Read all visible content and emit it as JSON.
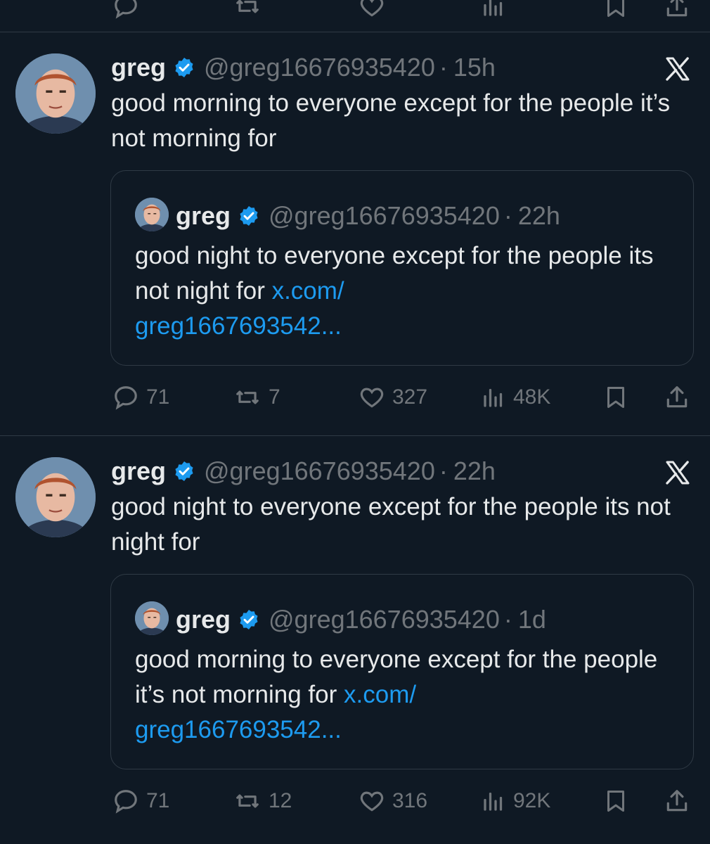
{
  "colors": {
    "background": "#0f1924",
    "text": "#e7e9ea",
    "muted": "#71767b",
    "link": "#1d9bf0",
    "verified": "#1d9bf0",
    "border": "#2f3a45"
  },
  "tweets": [
    {
      "name": "greg",
      "handle": "@greg16676935420",
      "dot": "·",
      "time": "15h",
      "text": "good morning to everyone except for the people it’s not morning for",
      "quote": {
        "name": "greg",
        "handle": "@greg16676935420",
        "dot": "·",
        "time": "22h",
        "text": "good night to everyone except for the people its not night for ",
        "link_line1": "x.com/",
        "link_line2": "greg1667693542..."
      },
      "stats": {
        "replies": "71",
        "reposts": "7",
        "likes": "327",
        "views": "48K"
      }
    },
    {
      "name": "greg",
      "handle": "@greg16676935420",
      "dot": "·",
      "time": "22h",
      "text": "good night to everyone except for the people its not night for",
      "quote": {
        "name": "greg",
        "handle": "@greg16676935420",
        "dot": "·",
        "time": "1d",
        "text": "good morning to everyone except for the people it’s not morning for ",
        "link_line1": "x.com/",
        "link_line2": "greg1667693542..."
      },
      "stats": {
        "replies": "71",
        "reposts": "12",
        "likes": "316",
        "views": "92K"
      }
    }
  ]
}
